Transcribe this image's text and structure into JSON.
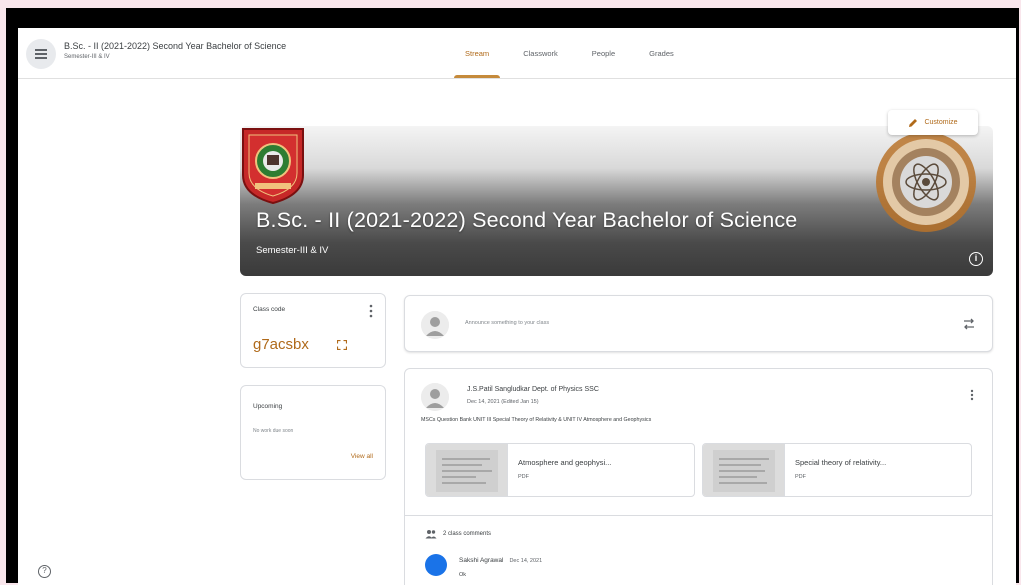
{
  "header": {
    "course_title": "B.Sc. - II (2021-2022) Second Year Bachelor of Science",
    "course_section": "Semester-III & IV",
    "tabs": [
      {
        "label": "Stream",
        "active": true
      },
      {
        "label": "Classwork",
        "active": false
      },
      {
        "label": "People",
        "active": false
      },
      {
        "label": "Grades",
        "active": false
      }
    ]
  },
  "banner": {
    "title": "B.Sc. - II (2021-2022) Second Year Bachelor of Science",
    "subtitle": "Semester-III & IV",
    "customize_label": "Customize"
  },
  "class_code": {
    "label": "Class code",
    "value": "g7acsbx"
  },
  "upcoming": {
    "label": "Upcoming",
    "empty_text": "No work due soon",
    "view_all": "View all"
  },
  "announce": {
    "placeholder": "Announce something to your class"
  },
  "post": {
    "author": "J.S.Patil Sangludkar Dept. of Physics SSC",
    "date": "Dec 14, 2021 (Edited Jan 15)",
    "body": "MSCs Question Bank UNIT III Special Theory of Relativity & UNIT IV Atmosphere and Geophysics",
    "attachments": [
      {
        "name": "Atmosphere and geophysi...",
        "type": "PDF"
      },
      {
        "name": "Special theory of relativity...",
        "type": "PDF"
      }
    ],
    "comments_label": "2 class comments",
    "comment": {
      "author": "Sakshi Agrawal",
      "date": "Dec 14, 2021",
      "text": "Ok"
    }
  },
  "colors": {
    "accent": "#b06a1a",
    "tab_underline": "#c58a3b",
    "comment_avatar": "#1a73e8"
  }
}
